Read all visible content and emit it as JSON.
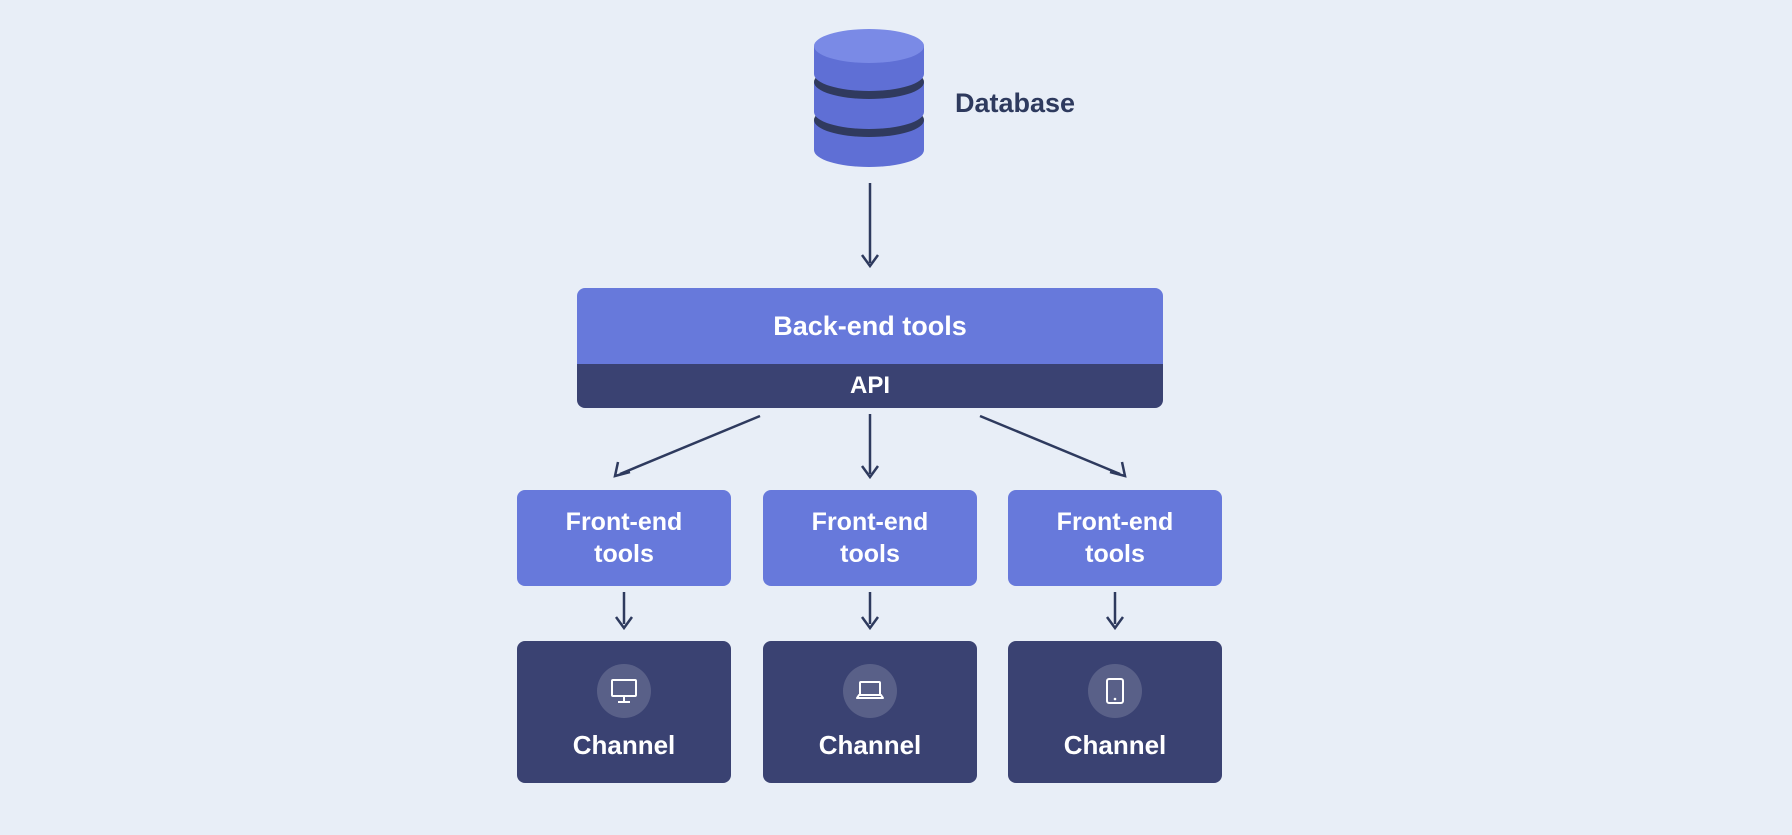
{
  "labels": {
    "database": "Database",
    "backend": "Back-end tools",
    "api": "API",
    "frontend": [
      "Front-end\ntools",
      "Front-end\ntools",
      "Front-end\ntools"
    ],
    "channel": [
      "Channel",
      "Channel",
      "Channel"
    ]
  },
  "colors": {
    "background": "#e8eef7",
    "light": "#6779db",
    "dark": "#3a4272",
    "text": "#2e3a5e",
    "dbTop": "#7a8ae6",
    "dbSide": "#5f6fd5"
  },
  "icons": {
    "channels": [
      "desktop-icon",
      "laptop-icon",
      "tablet-icon"
    ]
  }
}
